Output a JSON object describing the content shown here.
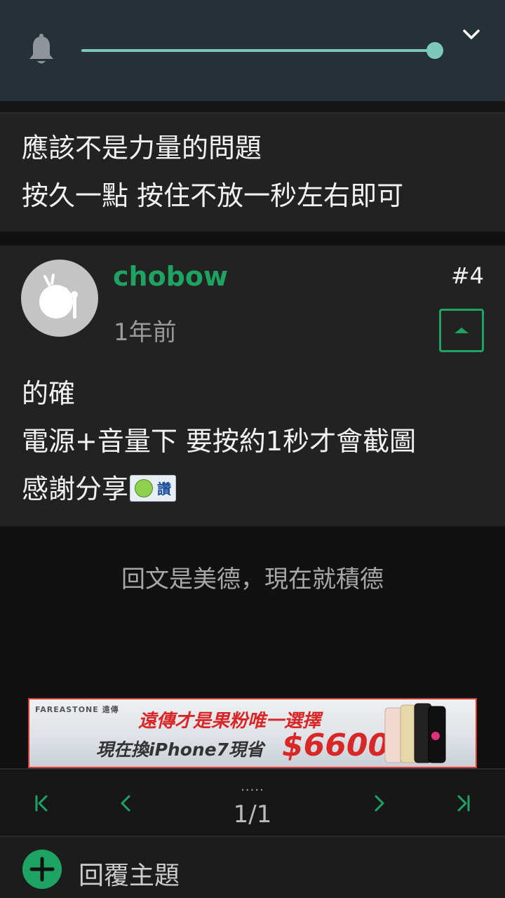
{
  "volume_panel": {
    "bell_icon": "bell-icon",
    "collapse_icon": "chevron-down-icon",
    "accent_color": "#7cc9bc",
    "volume_level": 1.0
  },
  "previous_post": {
    "lines": [
      "應該不是力量的問題",
      "按久一點 按住不放一秒左右即可"
    ]
  },
  "post": {
    "username": "chobow",
    "time": "1年前",
    "floor": "#4",
    "lines": [
      "的確",
      "電源+音量下 要按約1秒才會截圖",
      "感謝分享"
    ],
    "emoji_label": "讚",
    "accent_color": "#1fa362"
  },
  "reply_hint": "回文是美德，現在就積德",
  "ad": {
    "brand": "FAREASTONE 遠傳",
    "headline": "遠傳才是果粉唯一選擇",
    "subline": "現在換iPhone7現省",
    "price": "$6600",
    "border_color": "#d83a3a"
  },
  "pager": {
    "dots": ".....",
    "page": "1/1",
    "icons": [
      "first-page-icon",
      "prev-page-icon",
      "next-page-icon",
      "last-page-icon"
    ]
  },
  "reply_bar": {
    "label": "回覆主題",
    "icon": "plus-icon"
  }
}
